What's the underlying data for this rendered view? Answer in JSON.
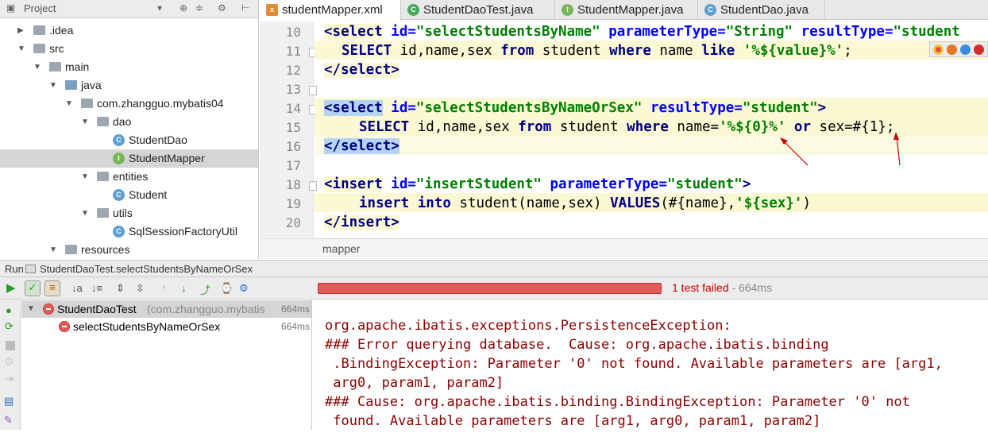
{
  "project_panel": {
    "title": "Project",
    "tree": [
      {
        "label": ".idea",
        "type": "folder"
      },
      {
        "label": "src",
        "type": "folder"
      },
      {
        "label": "main",
        "type": "folder"
      },
      {
        "label": "java",
        "type": "source-folder"
      },
      {
        "label": "com.zhangguo.mybatis04",
        "type": "package"
      },
      {
        "label": "dao",
        "type": "package"
      },
      {
        "label": "StudentDao",
        "type": "class"
      },
      {
        "label": "StudentMapper",
        "type": "interface"
      },
      {
        "label": "entities",
        "type": "package"
      },
      {
        "label": "Student",
        "type": "class"
      },
      {
        "label": "utils",
        "type": "package"
      },
      {
        "label": "SqlSessionFactoryUtil",
        "type": "class"
      },
      {
        "label": "resources",
        "type": "folder"
      }
    ]
  },
  "editor": {
    "tabs": [
      {
        "label": "studentMapper.xml",
        "icon": "xml-file-icon",
        "active": true
      },
      {
        "label": "StudentDaoTest.java",
        "icon": "test-class-icon",
        "active": false
      },
      {
        "label": "StudentMapper.java",
        "icon": "interface-icon",
        "active": false
      },
      {
        "label": "StudentDao.java",
        "icon": "class-icon",
        "active": false
      }
    ],
    "line_numbers": [
      "10",
      "11",
      "12",
      "13",
      "14",
      "15",
      "16",
      "17",
      "18",
      "19",
      "20"
    ],
    "code": {
      "l10_tag": "<select",
      "l10_a1": " id=",
      "l10_v1": "\"selectStudentsByName\"",
      "l10_a2": " parameterType=",
      "l10_v2": "\"String\"",
      "l10_a3": " resultType=",
      "l10_v3": "\"student",
      "l11_kw1": "SELECT",
      "l11_t1": " id,name,sex ",
      "l11_kw2": "from",
      "l11_t2": " student ",
      "l11_kw3": "where",
      "l11_t3": " name ",
      "l11_kw4": "like",
      "l11_t4": " ",
      "l11_v": "'%${value}%'",
      "l11_t5": ";",
      "l12": "</select>",
      "l14_tag": "<select",
      "l14_a1": " id=",
      "l14_v1": "\"selectStudentsByNameOrSex\"",
      "l14_a2": " resultType=",
      "l14_v2": "\"student\"",
      "l14_end": ">",
      "l15_kw1": "SELECT",
      "l15_t1": " id,name,sex ",
      "l15_kw2": "from",
      "l15_t2": " student ",
      "l15_kw3": "where",
      "l15_t3": " name=",
      "l15_v": "'%${0}%'",
      "l15_t4": " ",
      "l15_kw4": "or",
      "l15_t5": " sex=#{1};",
      "l16": "</select>",
      "l18_tag": "<insert",
      "l18_a1": " id=",
      "l18_v1": "\"insertStudent\"",
      "l18_a2": " parameterType=",
      "l18_v2": "\"student\"",
      "l18_end": ">",
      "l19_kw1": "insert",
      "l19_t1": " ",
      "l19_kw2": "into",
      "l19_t2": " student(name,sex) ",
      "l19_kw3": "VALUES",
      "l19_t3": "(#{name},",
      "l19_v": "'${sex}'",
      "l19_t4": ")",
      "l20": "</insert>"
    },
    "breadcrumb": "mapper"
  },
  "run_panel": {
    "label": "Run",
    "config_name": "StudentDaoTest.selectStudentsByNameOrSex",
    "status_text": "1 test failed",
    "status_time": " - 664ms",
    "tests": [
      {
        "name": "StudentDaoTest",
        "package": "(com.zhangguo.mybatis",
        "duration": "664ms",
        "status": "failed"
      },
      {
        "name": "selectStudentsByNameOrSex",
        "duration": "664ms",
        "status": "failed"
      }
    ],
    "output_lines": [
      "org.apache.ibatis.exceptions.PersistenceException: ",
      "### Error querying database.  Cause: org.apache.ibatis.binding",
      " .BindingException: Parameter '0' not found. Available parameters are [arg1,",
      " arg0, param1, param2]",
      "### Cause: org.apache.ibatis.binding.BindingException: Parameter '0' not",
      " found. Available parameters are [arg1, arg0, param1, param2]"
    ]
  },
  "colors": {
    "error": "#cc0000",
    "progress_failed": "#e25a5a",
    "xml_tag": "#000080",
    "xml_attr": "#0000ff",
    "xml_value": "#008000",
    "line_highlight": "#fbf8d4",
    "annotation_arrow": "#cc0000"
  }
}
